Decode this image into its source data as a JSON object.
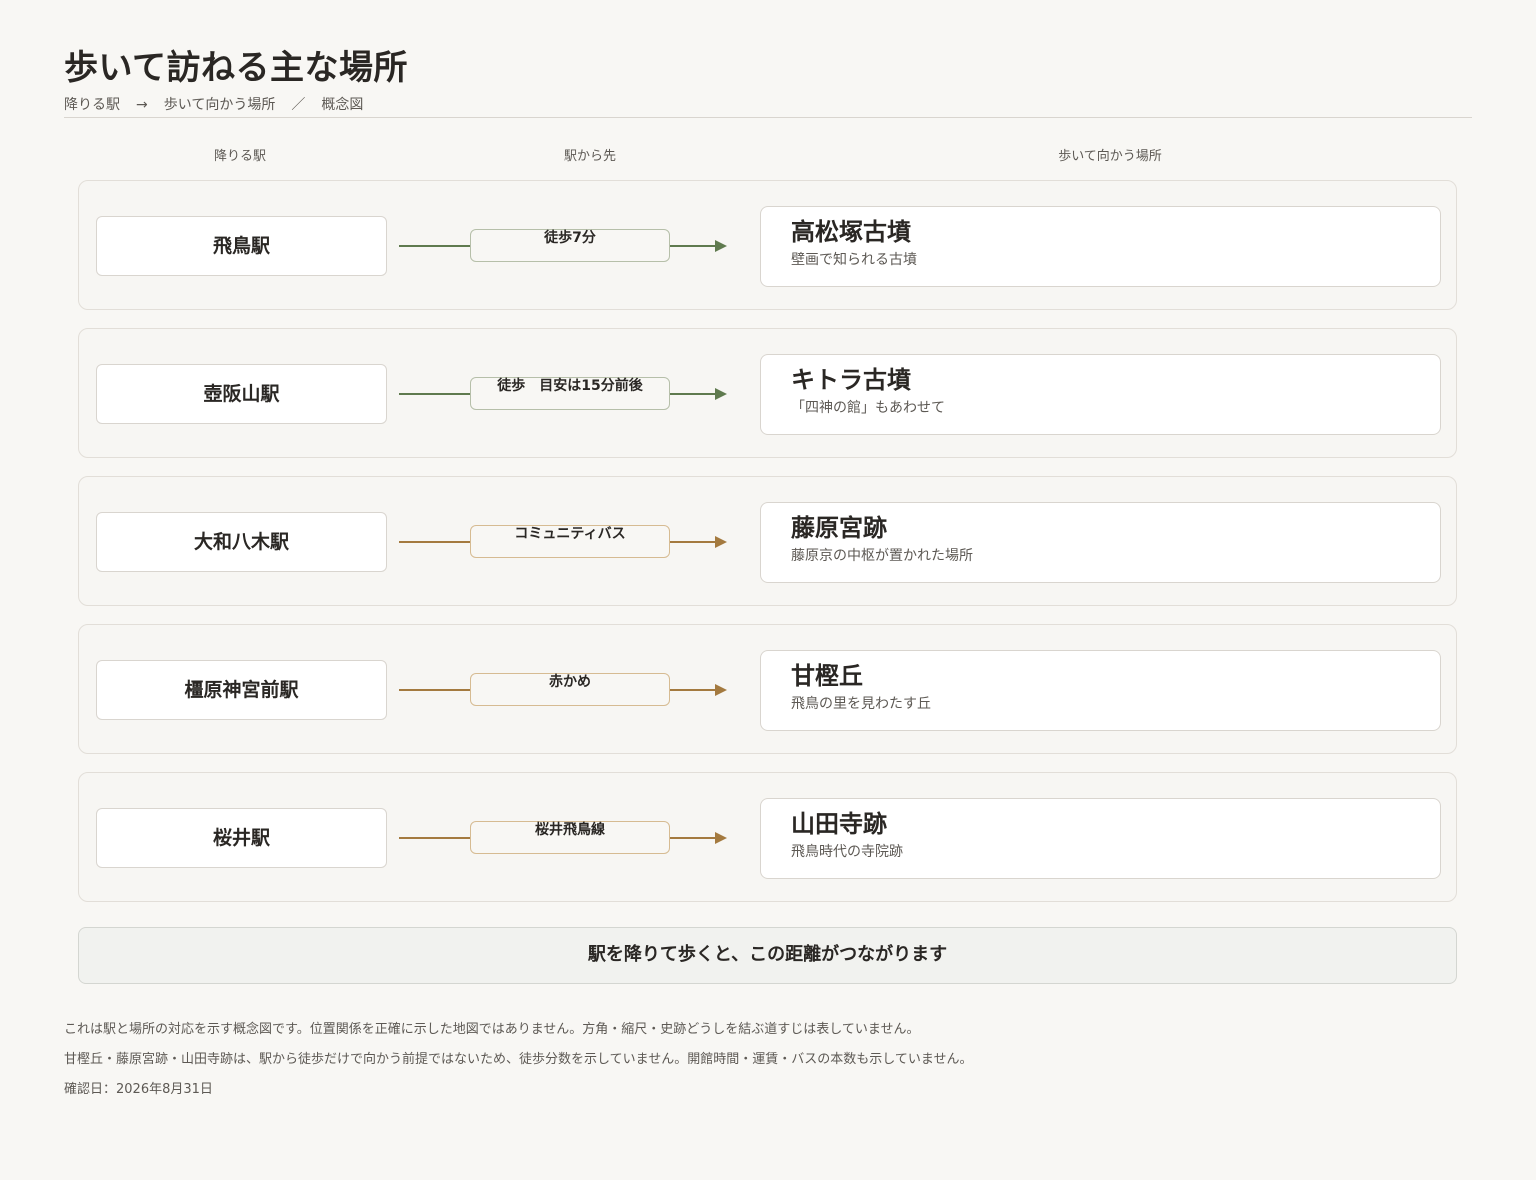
{
  "header": {
    "title": "歩いて訪ねる主な場所",
    "subtitle": {
      "part1": "降りる駅",
      "arrow": "→",
      "part2": "歩いて向かう場所",
      "slash": "／",
      "part3": "概念図"
    }
  },
  "columns": {
    "station": "降りる駅",
    "connection": "駅から先",
    "place": "歩いて向かう場所"
  },
  "routes": [
    {
      "station": "飛鳥駅",
      "mode": "徒歩7分",
      "mode_type": "walk",
      "place": "高松塚古墳",
      "desc": "壁画で知られる古墳"
    },
    {
      "station": "壺阪山駅",
      "mode": "徒歩　目安は15分前後",
      "mode_type": "walk",
      "place": "キトラ古墳",
      "desc": "「四神の館」もあわせて"
    },
    {
      "station": "大和八木駅",
      "mode": "コミュニティバス",
      "mode_type": "bus",
      "place": "藤原宮跡",
      "desc": "藤原京の中枢が置かれた場所"
    },
    {
      "station": "橿原神宮前駅",
      "mode": "赤かめ",
      "mode_type": "bus",
      "place": "甘樫丘",
      "desc": "飛鳥の里を見わたす丘"
    },
    {
      "station": "桜井駅",
      "mode": "桜井飛鳥線",
      "mode_type": "bus",
      "place": "山田寺跡",
      "desc": "飛鳥時代の寺院跡"
    }
  ],
  "summary": "駅を降りて歩くと、この距離がつながります",
  "notes": [
    "これは駅と場所の対応を示す概念図です。位置関係を正確に示した地図ではありません。方角・縮尺・史跡どうしを結ぶ道すじは表していません。",
    "甘樫丘・藤原宮跡・山田寺跡は、駅から徒歩だけで向かう前提ではないため、徒歩分数を示していません。開館時間・運賃・バスの本数も示していません。",
    "確認日：2026年8月31日"
  ],
  "colors": {
    "walk": "#5f7a4e",
    "bus": "#a47a3f",
    "background": "#f8f7f4"
  }
}
